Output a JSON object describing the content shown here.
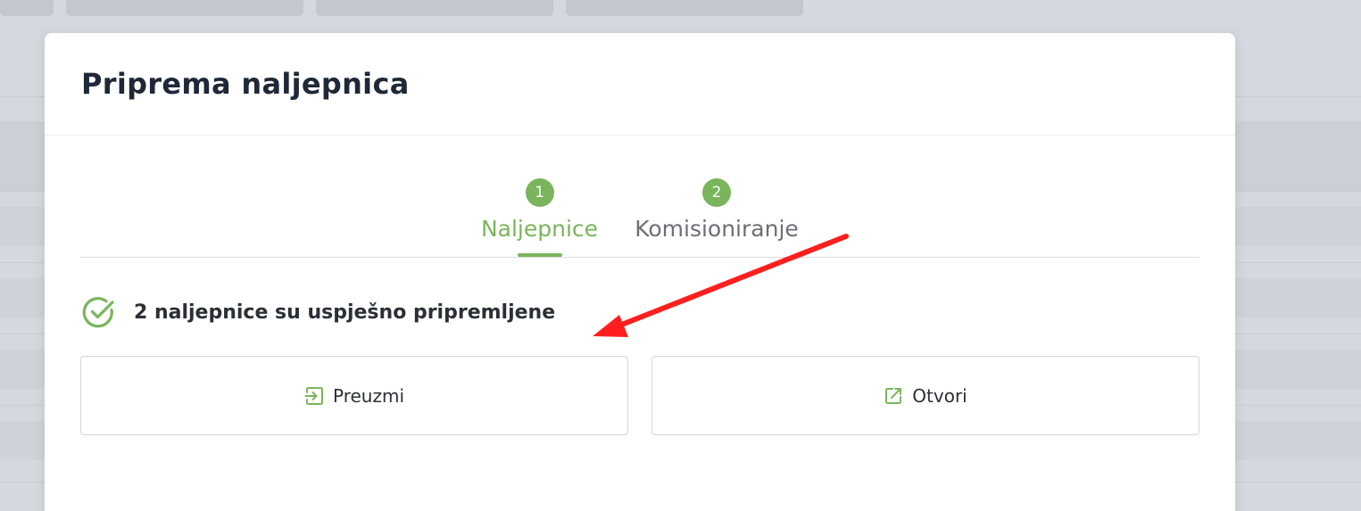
{
  "colors": {
    "accent": "#7ab55c",
    "title": "#1e2838",
    "text": "#2b2f36",
    "muted": "#6b6f75",
    "annotation": "#ff1f1f"
  },
  "modal": {
    "title": "Priprema naljepnica"
  },
  "stepper": {
    "steps": [
      {
        "number": "1",
        "label": "Naljepnice",
        "active": true
      },
      {
        "number": "2",
        "label": "Komisioniranje",
        "active": false
      }
    ]
  },
  "status": {
    "icon": "check-circle-icon",
    "message": "2 naljepnice su uspješno pripremljene"
  },
  "actions": {
    "download": {
      "label": "Preuzmi",
      "icon": "sign-in-icon"
    },
    "open": {
      "label": "Otvori",
      "icon": "external-link-icon"
    }
  }
}
